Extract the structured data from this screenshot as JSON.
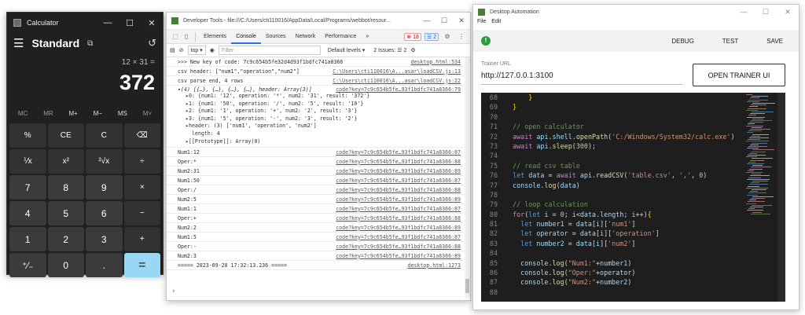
{
  "calculator": {
    "title": "Calculator",
    "window_controls": [
      "—",
      "☐",
      "✕"
    ],
    "mode": "Standard",
    "menu_glyph": "☰",
    "keep_on_top_glyph": "⧉",
    "history_glyph": "↺",
    "expression": "12 × 31 =",
    "result": "372",
    "memory": [
      "MC",
      "MR",
      "M+",
      "M−",
      "MS",
      "M˅"
    ],
    "keys": [
      "%",
      "CE",
      "C",
      "⌫",
      "⅟x",
      "x²",
      "²√x",
      "÷",
      "7",
      "8",
      "9",
      "×",
      "4",
      "5",
      "6",
      "−",
      "1",
      "2",
      "3",
      "+",
      "⁺∕₋",
      "0",
      ".",
      "="
    ]
  },
  "devtools": {
    "title": "Developer Tools - file:///C:/Users/cti110016/AppData/Local/Programs/webbot/resour...",
    "window_controls": [
      "—",
      "☐",
      "✕"
    ],
    "tabs": [
      "Elements",
      "Console",
      "Sources",
      "Network",
      "Performance",
      "»"
    ],
    "active_tab": "Console",
    "error_count": "⊗ 18",
    "message_count": "☰ 2",
    "context": "top ▾",
    "filter_placeholder": "Filter",
    "levels": "Default levels ▾",
    "issues": "2 Issues: ☰ 2",
    "lines_top": [
      {
        "msg": ">>> New key of code: 7c9c654b5fe32d4d93f1bdfc741a8366",
        "src": "desktop.html:534"
      },
      {
        "msg": "csv header: [\"num1\",\"operation\",\"num2\"]",
        "src": "C:\\Users\\cti110016\\A...asar\\loadCSV.js:13"
      },
      {
        "msg": "csv parse end, 4 rows",
        "src": "C:\\Users\\cti110016\\A...asar\\loadCSV.js:22"
      },
      {
        "msg": "",
        "src": "code?key=7c9c654b5fe…93f1bdfc741a8366:79"
      }
    ],
    "object_header": "▾(4) [{…}, {…}, {…}, {…}, header: Array(3)]",
    "object_info": "i",
    "object_rows": [
      "▸0: {num1: '12', operation: '*', num2: '31', result: '372'}",
      "▸1: {num1: '50', operation: '/', num2: '5', result: '10'}",
      "▸2: {num1: '1', operation: '+', num2: '2', result: '3'}",
      "▸3: {num1: '5', operation: '-', num2: '3', result: '2'}",
      "▸header: (3) ['num1', 'operation', 'num2']",
      "  length: 4",
      "▸[[Prototype]]: Array(0)"
    ],
    "lines_bottom": [
      {
        "msg": "Num1:12",
        "src": "code?key=7c9c654b5fe…93f1bdfc741a8366:87"
      },
      {
        "msg": "Oper:*",
        "src": "code?key=7c9c654b5fe…93f1bdfc741a8366:88"
      },
      {
        "msg": "Num2:31",
        "src": "code?key=7c9c654b5fe…93f1bdfc741a8366:89"
      },
      {
        "msg": "Num1:50",
        "src": "code?key=7c9c654b5fe…93f1bdfc741a8366:87"
      },
      {
        "msg": "Oper:/",
        "src": "code?key=7c9c654b5fe…93f1bdfc741a8366:88"
      },
      {
        "msg": "Num2:5",
        "src": "code?key=7c9c654b5fe…93f1bdfc741a8366:89"
      },
      {
        "msg": "Num1:1",
        "src": "code?key=7c9c654b5fe…93f1bdfc741a8366:87"
      },
      {
        "msg": "Oper:+",
        "src": "code?key=7c9c654b5fe…93f1bdfc741a8366:88"
      },
      {
        "msg": "Num2:2",
        "src": "code?key=7c9c654b5fe…93f1bdfc741a8366:89"
      },
      {
        "msg": "Num1:5",
        "src": "code?key=7c9c654b5fe…93f1bdfc741a8366:87"
      },
      {
        "msg": "Oper:-",
        "src": "code?key=7c9c654b5fe…93f1bdfc741a8366:88"
      },
      {
        "msg": "Num2:3",
        "src": "code?key=7c9c654b5fe…93f1bdfc741a8366:89"
      },
      {
        "msg": "===== 2023-09-28 17:32:13.236 =====",
        "src": "desktop.html:1273"
      }
    ],
    "prompt": "›"
  },
  "automation": {
    "title": "Desktop Automation",
    "window_controls": [
      "—",
      "☐",
      "✕"
    ],
    "menu": [
      "File",
      "Edit"
    ],
    "status_glyph": "!",
    "status_color": "#2e9c3c",
    "actions": [
      "DEBUG",
      "TEST",
      "SAVE"
    ],
    "trainer_url_label": "Trainer URL",
    "trainer_url": "http://127.0.0.1:3100",
    "open_button": "OPEN TRAINER UI",
    "code": [
      {
        "ln": "68",
        "html": "      <span class=\"br\">}</span>"
      },
      {
        "ln": "69",
        "html": "  <span class=\"br\">}</span>"
      },
      {
        "ln": "70",
        "html": ""
      },
      {
        "ln": "71",
        "html": "  <span class=\"cm\">// open calculator</span>"
      },
      {
        "ln": "72",
        "html": "  <span class=\"kw2\">await</span> <span class=\"v\">api</span>.<span class=\"v\">shell</span>.<span class=\"fn\">openPath</span>(<span class=\"s\">'C:/Windows/System32/calc.exe'</span>)"
      },
      {
        "ln": "73",
        "html": "  <span class=\"kw2\">await</span> <span class=\"v\">api</span>.<span class=\"fn\">sleep</span>(<span class=\"n\">300</span>);"
      },
      {
        "ln": "74",
        "html": ""
      },
      {
        "ln": "75",
        "html": "  <span class=\"cm\">// read csv table</span>"
      },
      {
        "ln": "76",
        "html": "  <span class=\"kw\">let</span> <span class=\"v\">data</span> = <span class=\"kw2\">await</span> <span class=\"v\">api</span>.<span class=\"fn\">readCSV</span>(<span class=\"s\">'table.csv'</span>, <span class=\"s\">','</span>, <span class=\"n\">0</span>)"
      },
      {
        "ln": "77",
        "html": "  <span class=\"v\">console</span>.<span class=\"fn\">log</span>(<span class=\"v\">data</span>)"
      },
      {
        "ln": "78",
        "html": ""
      },
      {
        "ln": "79",
        "html": "  <span class=\"cm\">// loop calculation</span>"
      },
      {
        "ln": "80",
        "html": "  <span class=\"kw2\">for</span>(<span class=\"kw\">let</span> <span class=\"v\">i</span> = <span class=\"n\">0</span>; <span class=\"v\">i</span>&lt;<span class=\"v\">data</span>.<span class=\"v\">length</span>; <span class=\"v\">i</span>++)<span class=\"br\">{</span>"
      },
      {
        "ln": "81",
        "html": "    <span class=\"kw\">let</span> <span class=\"v\">number1</span> = <span class=\"v\">data</span>[<span class=\"v\">i</span>][<span class=\"s\">'num1'</span>]"
      },
      {
        "ln": "82",
        "html": "    <span class=\"kw\">let</span> <span class=\"v\">operator</span> = <span class=\"v\">data</span>[<span class=\"v\">i</span>][<span class=\"s\">'operation'</span>]"
      },
      {
        "ln": "83",
        "html": "    <span class=\"kw\">let</span> <span class=\"v\">number2</span> = <span class=\"v\">data</span>[<span class=\"v\">i</span>][<span class=\"s\">'num2'</span>]"
      },
      {
        "ln": "84",
        "html": ""
      },
      {
        "ln": "85",
        "html": "    <span class=\"v\">console</span>.<span class=\"fn\">log</span>(<span class=\"s\">\"Num1:\"</span>+<span class=\"v\">number1</span>)"
      },
      {
        "ln": "86",
        "html": "    <span class=\"v\">console</span>.<span class=\"fn\">log</span>(<span class=\"s\">\"Oper:\"</span>+<span class=\"v\">operator</span>)"
      },
      {
        "ln": "87",
        "html": "    <span class=\"v\">console</span>.<span class=\"fn\">log</span>(<span class=\"s\">\"Num2:\"</span>+<span class=\"v\">number2</span>)"
      },
      {
        "ln": "88",
        "html": ""
      }
    ]
  }
}
